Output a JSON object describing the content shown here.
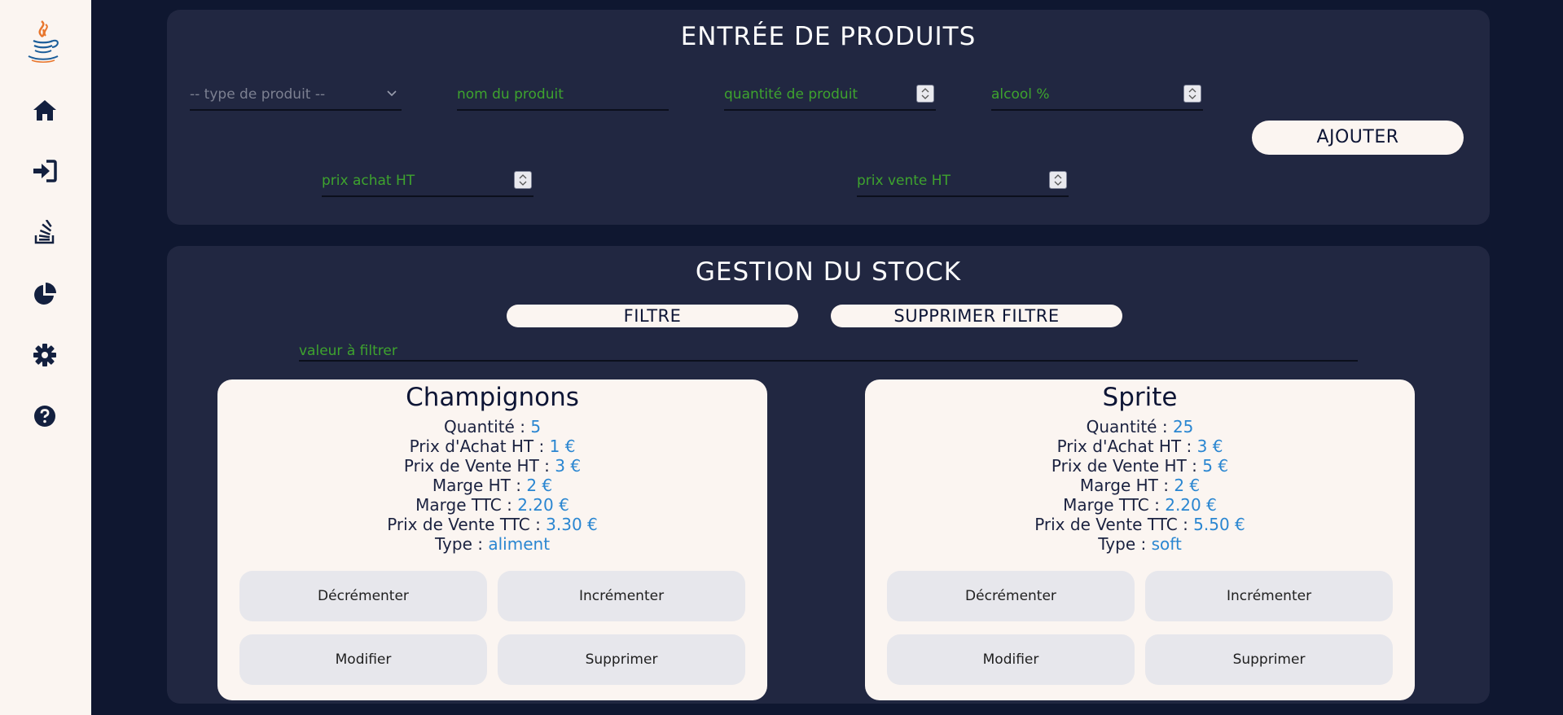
{
  "sidebar": {
    "icons": [
      "java-logo-icon",
      "home-icon",
      "login-icon",
      "stack-overflow-icon",
      "pie-chart-icon",
      "gear-icon",
      "help-icon"
    ]
  },
  "entry": {
    "title": "ENTRÉE DE PRODUITS",
    "type_placeholder": "-- type de produit --",
    "name_placeholder": "nom du produit",
    "quantity_placeholder": "quantité de produit",
    "alcohol_placeholder": "alcool %",
    "add_button": "AJOUTER",
    "purchase_price_placeholder": "prix achat HT",
    "sale_price_placeholder": "prix vente HT"
  },
  "stock": {
    "title": "GESTION DU STOCK",
    "filter_button": "FILTRE",
    "remove_filter_button": "SUPPRIMER FILTRE",
    "filter_placeholder": "valeur à filtrer",
    "cards": [
      {
        "name": "Champignons",
        "quantity_label": "Quantité :",
        "quantity": "5",
        "purchase_label": "Prix d'Achat HT :",
        "purchase": "1 €",
        "sale_label": "Prix de Vente HT :",
        "sale": "3 €",
        "margin_ht_label": "Marge HT :",
        "margin_ht": "2 €",
        "margin_ttc_label": "Marge TTC :",
        "margin_ttc": "2.20 €",
        "sale_ttc_label": "Prix de Vente TTC :",
        "sale_ttc": "3.30 €",
        "type_label": "Type :",
        "type": "aliment",
        "decrement": "Décrémenter",
        "increment": "Incrémenter",
        "edit": "Modifier",
        "delete": "Supprimer"
      },
      {
        "name": "Sprite",
        "quantity_label": "Quantité :",
        "quantity": "25",
        "purchase_label": "Prix d'Achat HT :",
        "purchase": "3 €",
        "sale_label": "Prix de Vente HT :",
        "sale": "5 €",
        "margin_ht_label": "Marge HT :",
        "margin_ht": "2 €",
        "margin_ttc_label": "Marge TTC :",
        "margin_ttc": "2.20 €",
        "sale_ttc_label": "Prix de Vente TTC :",
        "sale_ttc": "5.50 €",
        "type_label": "Type :",
        "type": "soft",
        "decrement": "Décrémenter",
        "increment": "Incrémenter",
        "edit": "Modifier",
        "delete": "Supprimer"
      }
    ]
  },
  "colors": {
    "background": "#0f1730",
    "panel": "#212741",
    "sidebar": "#fbf5f1",
    "placeholder_green": "#3ea32e",
    "value_blue": "#2a86d1",
    "navy": "#0d1535"
  }
}
